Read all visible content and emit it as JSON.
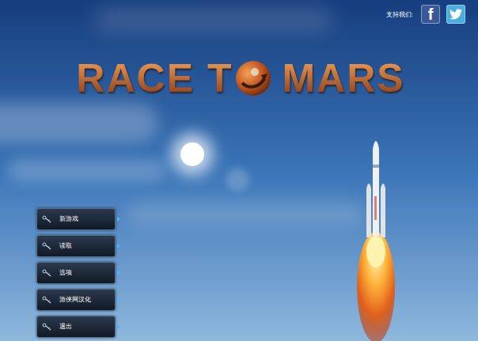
{
  "header": {
    "support_label": "支持我们:",
    "social": [
      {
        "name": "facebook",
        "glyph": "f",
        "color": "#3b5998"
      },
      {
        "name": "twitter",
        "glyph": "",
        "color": "#4aaee0"
      }
    ]
  },
  "title": {
    "before_planet": "RACE T",
    "after_planet": "MARS"
  },
  "menu": {
    "items": [
      {
        "label": "新游戏"
      },
      {
        "label": "读取"
      },
      {
        "label": "选项"
      },
      {
        "label": "游侠网汉化"
      },
      {
        "label": "退出"
      }
    ]
  }
}
